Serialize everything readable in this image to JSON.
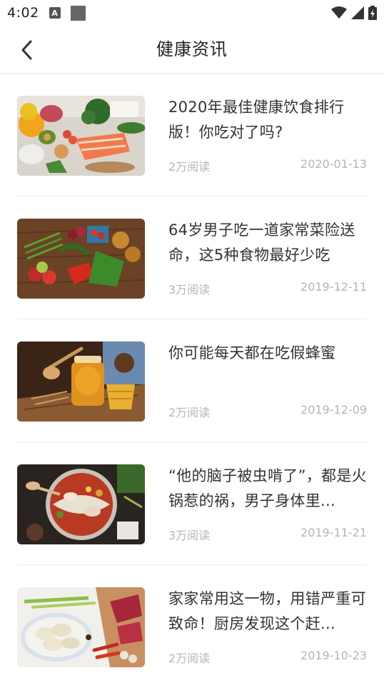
{
  "status_bar": {
    "time": "4:02",
    "icons": [
      "notification-a-icon",
      "notification-square-icon",
      "wifi-icon",
      "signal-icon",
      "battery-charging-icon"
    ]
  },
  "header": {
    "back_icon": "chevron-left-icon",
    "title": "健康资讯"
  },
  "articles": [
    {
      "title": "2020年最佳健康饮食排行版！你吃对了吗?",
      "reads": "2万阅读",
      "date": "2020-01-13",
      "image": "healthy-food-spread"
    },
    {
      "title": "64岁男子吃一道家常菜险送命，这5种食物最好少吃",
      "reads": "3万阅读",
      "date": "2019-12-11",
      "image": "vegetables-on-wood"
    },
    {
      "title": "你可能每天都在吃假蜂蜜",
      "reads": "2万阅读",
      "date": "2019-12-09",
      "image": "honey-jar"
    },
    {
      "title": "“他的脑子被虫啃了”，都是火锅惹的祸，男子身体里...",
      "reads": "3万阅读",
      "date": "2019-11-21",
      "image": "hotpot"
    },
    {
      "title": "家家常用这一物，用错严重可致命！厨房发现这个赶...",
      "reads": "2万阅读",
      "date": "2019-10-23",
      "image": "dumplings-and-meat"
    }
  ]
}
